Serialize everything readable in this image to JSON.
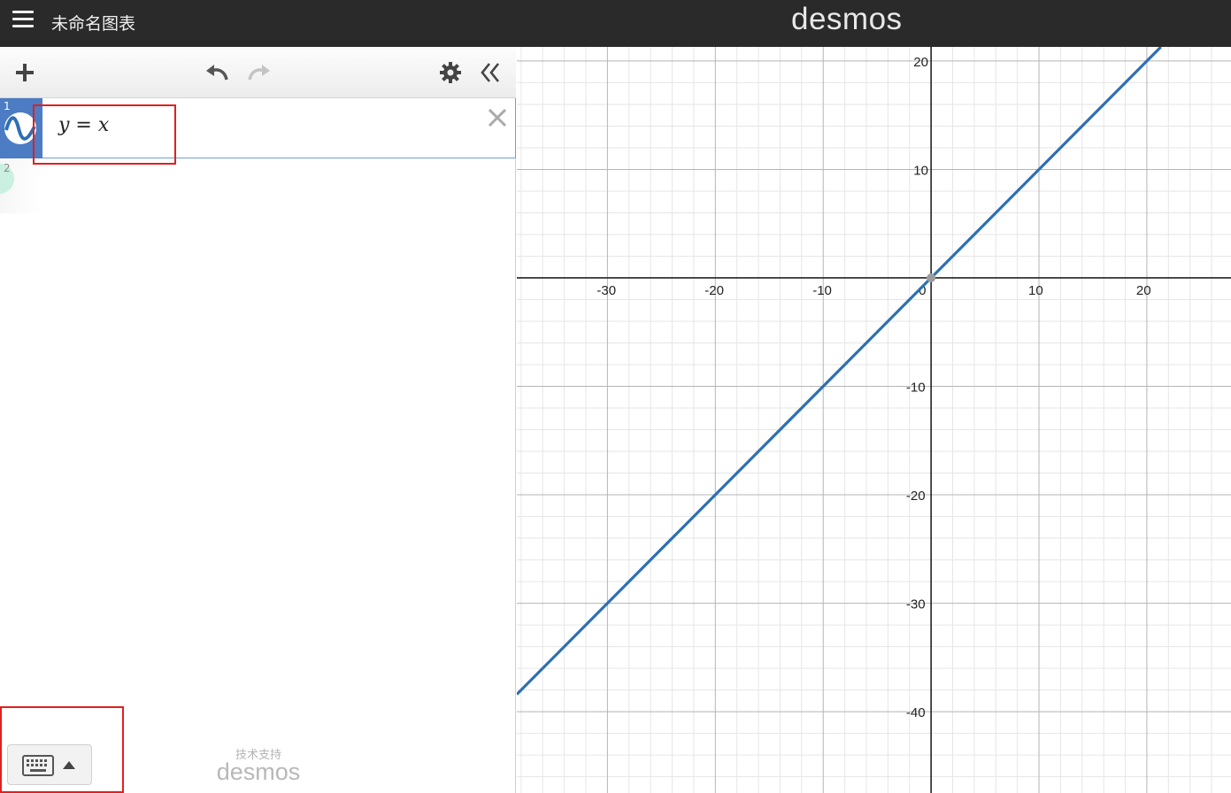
{
  "header": {
    "menu_icon": "hamburger-menu-icon",
    "title": "未命名图表",
    "brand": "desmos"
  },
  "toolbar": {
    "add_icon": "plus-icon",
    "undo_icon": "undo-icon",
    "redo_icon": "redo-icon",
    "settings_icon": "gear-icon",
    "collapse_icon": "double-chevron-left-icon"
  },
  "expressions": [
    {
      "index": "1",
      "latex": "y = x",
      "color": "#2d70b3",
      "icon": "sine-wave-icon"
    },
    {
      "index": "2",
      "latex": "",
      "icon": "new-expression-icon"
    }
  ],
  "footer": {
    "keyboard_icon": "keyboard-icon",
    "caret_icon": "caret-up-icon",
    "powered_label": "技术支持",
    "powered_brand": "desmos"
  },
  "colors": {
    "highlight_box": "#e02020",
    "active_tab": "#4c7cc4",
    "curve": "#2d70b3"
  },
  "chart_data": {
    "type": "line",
    "title": "",
    "xlabel": "",
    "ylabel": "",
    "xlim": [
      -38.4,
      27.8
    ],
    "ylim": [
      -47.5,
      21.3
    ],
    "grid": true,
    "x_ticks": [
      -30,
      -20,
      -10,
      0,
      10,
      20
    ],
    "y_ticks": [
      20,
      10,
      -10,
      -20,
      -30,
      -40
    ],
    "series": [
      {
        "x": [
          -38.4,
          21.3
        ],
        "y": [
          -38.4,
          21.3
        ],
        "color": "#2d70b3"
      }
    ],
    "points": [
      {
        "x": 0,
        "y": 0
      }
    ]
  }
}
